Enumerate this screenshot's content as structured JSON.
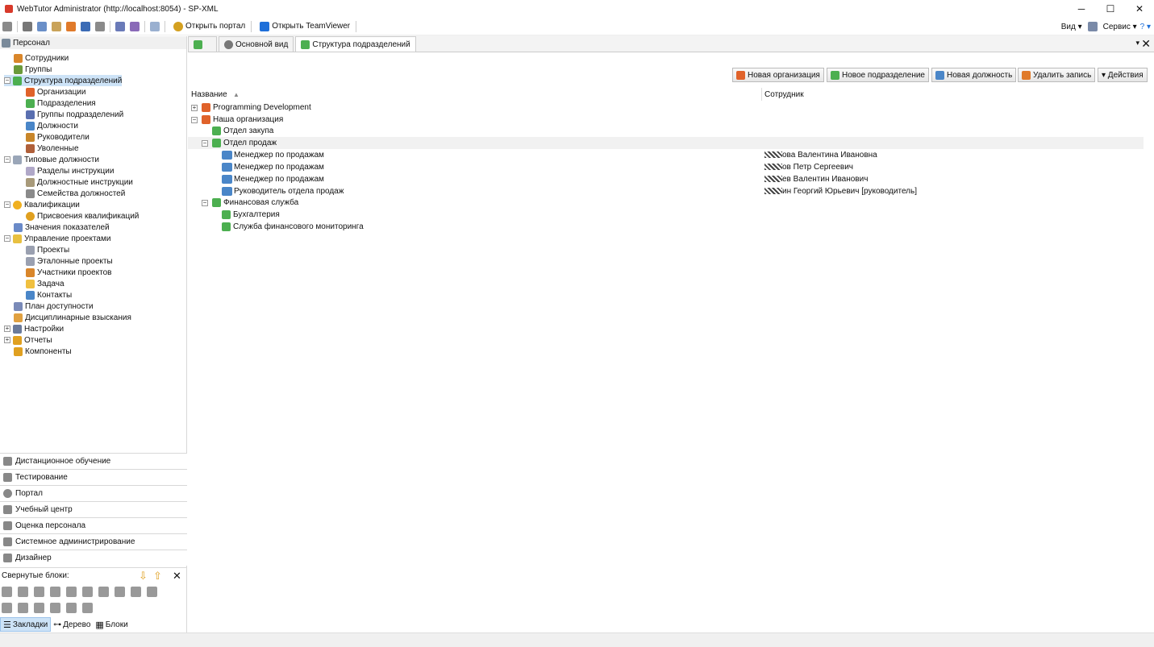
{
  "window": {
    "title": "WebTutor Administrator (http://localhost:8054) - SP-XML",
    "min": "─",
    "max": "☐",
    "close": "✕"
  },
  "toolbar": {
    "open_portal": "Открыть портал",
    "open_teamviewer": "Открыть TeamViewer",
    "view_menu": "Вид ▾",
    "service_menu": "Сервис ▾",
    "help": "? ▾"
  },
  "sidebar": {
    "header": "Персонал",
    "items": [
      {
        "label": "Сотрудники"
      },
      {
        "label": "Группы"
      },
      {
        "label": "Структура подразделений"
      },
      {
        "label": "Организации"
      },
      {
        "label": "Подразделения"
      },
      {
        "label": "Группы подразделений"
      },
      {
        "label": "Должности"
      },
      {
        "label": "Руководители"
      },
      {
        "label": "Уволенные"
      },
      {
        "label": "Типовые должности"
      },
      {
        "label": "Разделы инструкции"
      },
      {
        "label": "Должностные инструкции"
      },
      {
        "label": "Семейства должностей"
      },
      {
        "label": "Квалификации"
      },
      {
        "label": "Присвоения квалификаций"
      },
      {
        "label": "Значения показателей"
      },
      {
        "label": "Управление проектами"
      },
      {
        "label": "Проекты"
      },
      {
        "label": "Эталонные проекты"
      },
      {
        "label": "Участники проектов"
      },
      {
        "label": "Задача"
      },
      {
        "label": "Контакты"
      },
      {
        "label": "План доступности"
      },
      {
        "label": "Дисциплинарные взыскания"
      },
      {
        "label": "Настройки"
      },
      {
        "label": "Отчеты"
      },
      {
        "label": "Компоненты"
      }
    ],
    "categories": [
      {
        "label": "Дистанционное обучение"
      },
      {
        "label": "Тестирование"
      },
      {
        "label": "Портал"
      },
      {
        "label": "Учебный центр"
      },
      {
        "label": "Оценка персонала"
      },
      {
        "label": "Системное администрирование"
      },
      {
        "label": "Дизайнер"
      }
    ],
    "collapsed_label": "Свернутые блоки:",
    "view_tabs": [
      {
        "label": "Закладки"
      },
      {
        "label": "Дерево"
      },
      {
        "label": "Блоки"
      }
    ]
  },
  "tabs": [
    {
      "label": "Основной вид"
    },
    {
      "label": "Структура подразделений"
    }
  ],
  "actions": {
    "new_org": "Новая организация",
    "new_subdivision": "Новое подразделение",
    "new_position": "Новая должность",
    "delete_record": "Удалить запись",
    "actions_menu": "▾ Действия"
  },
  "grid": {
    "col_name": "Название",
    "col_employee": "Сотрудник",
    "rows": [
      {
        "name": "Programming Development",
        "employee": ""
      },
      {
        "name": "Наша организация",
        "employee": ""
      },
      {
        "name": "Отдел закупа",
        "employee": ""
      },
      {
        "name": "Отдел продаж",
        "employee": ""
      },
      {
        "name": "Менеджер по продажам",
        "employee": "ова Валентина Ивановна"
      },
      {
        "name": "Менеджер по продажам",
        "employee": "ов Петр Сергеевич"
      },
      {
        "name": "Менеджер по продажам",
        "employee": "ев Валентин Иванович"
      },
      {
        "name": "Руководитель отдела продаж",
        "employee": "ин Георгий Юрьевич [руководитель]"
      },
      {
        "name": "Финансовая служба",
        "employee": ""
      },
      {
        "name": "Бухгалтерия",
        "employee": ""
      },
      {
        "name": "Служба финансового мониторинга",
        "employee": ""
      }
    ]
  },
  "colors": {
    "org_icon": "#e0622a",
    "subdiv_icon": "#4caf50",
    "position_icon": "#4a86c8",
    "selection": "#cde3f7"
  }
}
